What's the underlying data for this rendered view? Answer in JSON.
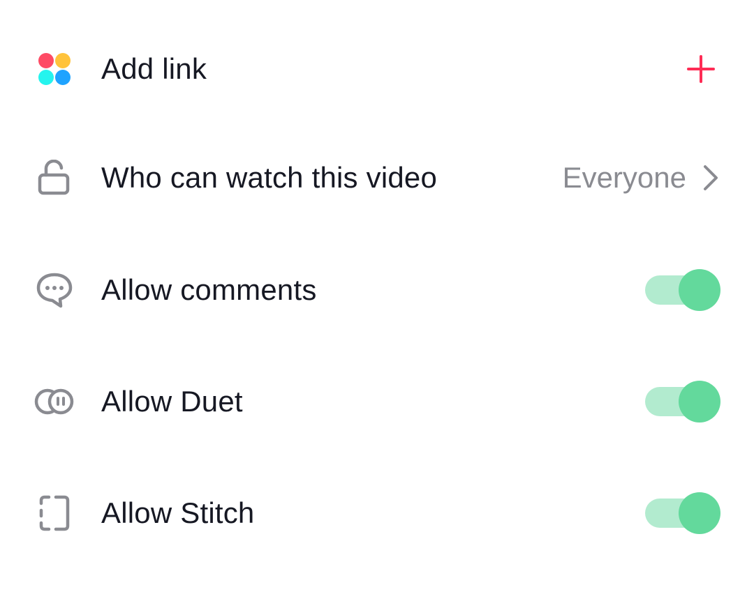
{
  "colors": {
    "text": "#161823",
    "secondary_text": "#8a8b91",
    "icon_gray": "#8a8b91",
    "accent_red": "#fe2c55",
    "toggle_track_on": "#b2ebcf",
    "toggle_knob_on": "#63d99c",
    "dot_red": "#fe4b65",
    "dot_yellow": "#ffc33b",
    "dot_cyan": "#25f4ee",
    "dot_blue": "#1fa3ff"
  },
  "rows": {
    "add_link": {
      "icon": "four-dots-icon",
      "label": "Add link",
      "action_icon": "plus-icon"
    },
    "who_can_watch": {
      "icon": "unlock-icon",
      "label": "Who can watch this video",
      "value": "Everyone",
      "action_icon": "chevron-right-icon"
    },
    "allow_comments": {
      "icon": "comment-bubble-icon",
      "label": "Allow comments",
      "enabled": true
    },
    "allow_duet": {
      "icon": "duet-icon",
      "label": "Allow Duet",
      "enabled": true
    },
    "allow_stitch": {
      "icon": "stitch-icon",
      "label": "Allow Stitch",
      "enabled": true
    }
  }
}
